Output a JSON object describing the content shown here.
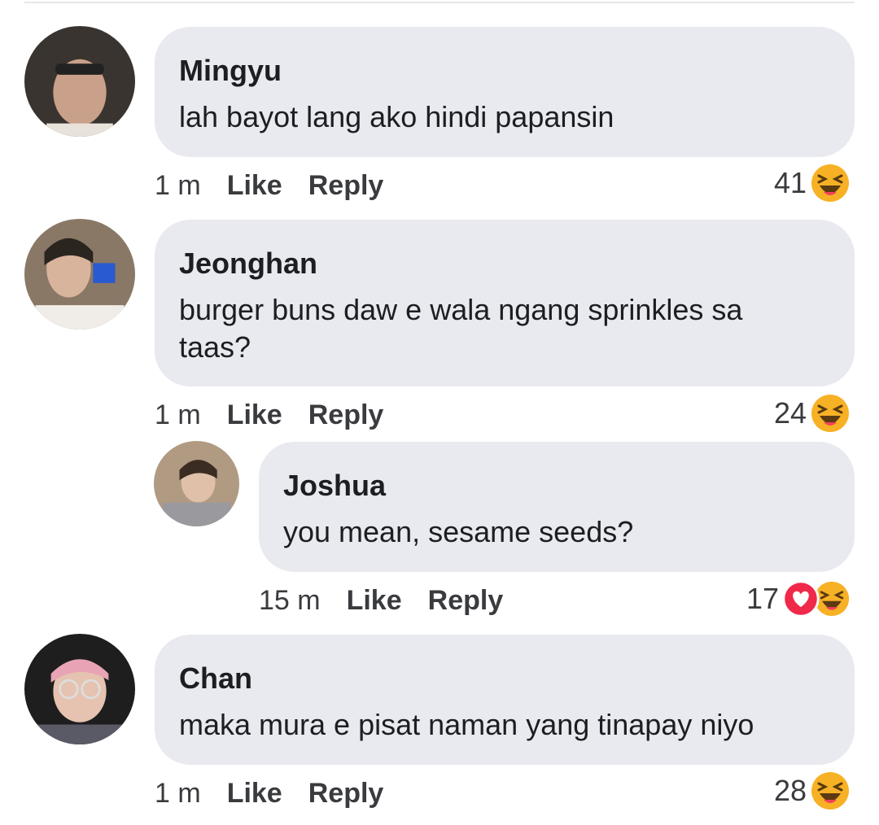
{
  "comments": [
    {
      "name": "Mingyu",
      "text": "lah bayot lang ako hindi papansin",
      "time": "1 m",
      "like": "Like",
      "reply": "Reply",
      "count": "41",
      "reactions": [
        "haha-icon"
      ]
    },
    {
      "name": "Jeonghan",
      "text": "burger buns daw e wala ngang sprinkles sa taas?",
      "time": "1 m",
      "like": "Like",
      "reply": "Reply",
      "count": "24",
      "reactions": [
        "haha-icon"
      ]
    },
    {
      "name": "Joshua",
      "text": "you mean, sesame seeds?",
      "time": "15 m",
      "like": "Like",
      "reply": "Reply",
      "count": "17",
      "reactions": [
        "love-icon",
        "haha-icon"
      ]
    },
    {
      "name": "Chan",
      "text": "maka mura e pisat naman yang tinapay niyo",
      "time": "1 m",
      "like": "Like",
      "reply": "Reply",
      "count": "28",
      "reactions": [
        "haha-icon"
      ]
    }
  ],
  "colors": {
    "bubble": "#e9e9f0",
    "love": "#f0284a",
    "haha": "#f7b125"
  }
}
